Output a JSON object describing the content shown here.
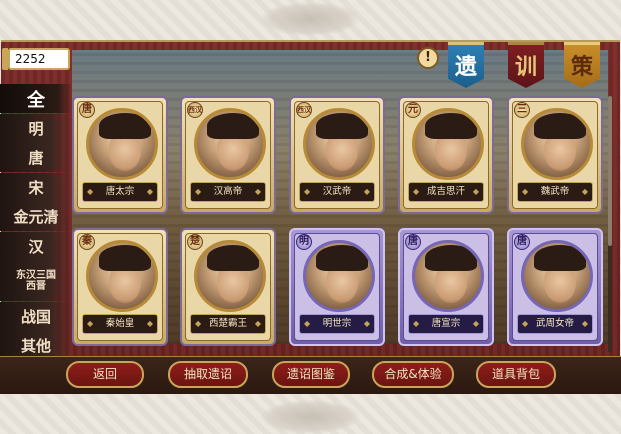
{
  "counter": {
    "value": "2252"
  },
  "header": {
    "alert_icon": "!",
    "banners": [
      "遗",
      "训",
      "策"
    ]
  },
  "dynasties": [
    {
      "label": "全",
      "active": true
    },
    {
      "label": "明"
    },
    {
      "label": "唐"
    },
    {
      "label": "宋"
    },
    {
      "label": "金元清"
    },
    {
      "label": "汉"
    },
    {
      "label": "东汉三国\n西晋"
    },
    {
      "label": "战国"
    },
    {
      "label": "其他"
    }
  ],
  "cards": [
    {
      "badge": "唐",
      "name": "唐太宗"
    },
    {
      "badge": "西汉",
      "name": "汉高帝"
    },
    {
      "badge": "西汉",
      "name": "汉武帝"
    },
    {
      "badge": "元",
      "name": "成吉思汗"
    },
    {
      "badge": "三",
      "name": "魏武帝"
    },
    {
      "badge": "秦",
      "name": "秦始皇"
    },
    {
      "badge": "楚",
      "name": "西楚霸王"
    },
    {
      "badge": "明",
      "name": "明世宗"
    },
    {
      "badge": "唐",
      "name": "唐宣宗"
    },
    {
      "badge": "唐",
      "name": "武周女帝"
    }
  ],
  "buttons": [
    "返回",
    "抽取遗诏",
    "遗诏图鉴",
    "合成&体验",
    "道具背包"
  ]
}
